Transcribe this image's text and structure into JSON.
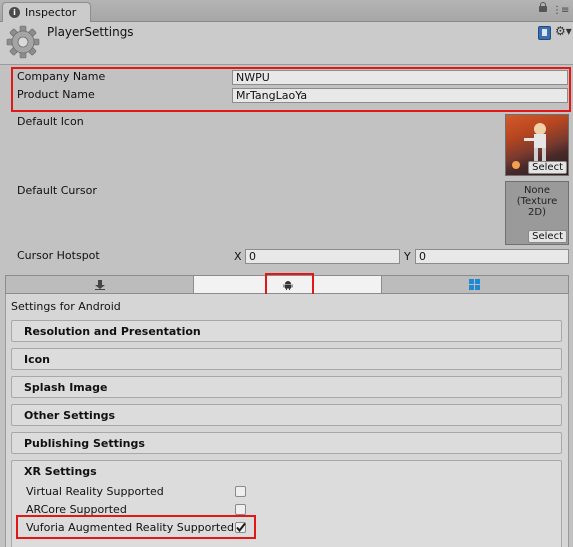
{
  "window": {
    "tab_label": "Inspector",
    "tab_icon": "info-icon",
    "menu_glyph": "⋮≡"
  },
  "header": {
    "title": "PlayerSettings"
  },
  "fields": {
    "company_label": "Company Name",
    "company_value": "NWPU",
    "product_label": "Product Name",
    "product_value": "MrTangLaoYa",
    "default_icon_label": "Default Icon",
    "default_cursor_label": "Default Cursor",
    "cursor_none_text": "None\n(Texture\n2D)",
    "select_label": "Select",
    "hotspot_label": "Cursor Hotspot",
    "hotspot_x_label": "X",
    "hotspot_x_value": "0",
    "hotspot_y_label": "Y",
    "hotspot_y_value": "0"
  },
  "platform_tabs": [
    {
      "icon": "download-icon"
    },
    {
      "icon": "android-icon",
      "selected": true
    },
    {
      "icon": "windows-icon"
    }
  ],
  "settings": {
    "heading": "Settings for Android",
    "sections": [
      "Resolution and Presentation",
      "Icon",
      "Splash Image",
      "Other Settings",
      "Publishing Settings"
    ],
    "xr": {
      "title": "XR Settings",
      "options": [
        {
          "label": "Virtual Reality Supported",
          "checked": false
        },
        {
          "label": "ARCore Supported",
          "checked": false
        },
        {
          "label": "Vuforia Augmented Reality Supported",
          "checked": true
        }
      ]
    }
  },
  "colors": {
    "highlight": "#e01818",
    "windows_blue": "#1e8ad6"
  }
}
